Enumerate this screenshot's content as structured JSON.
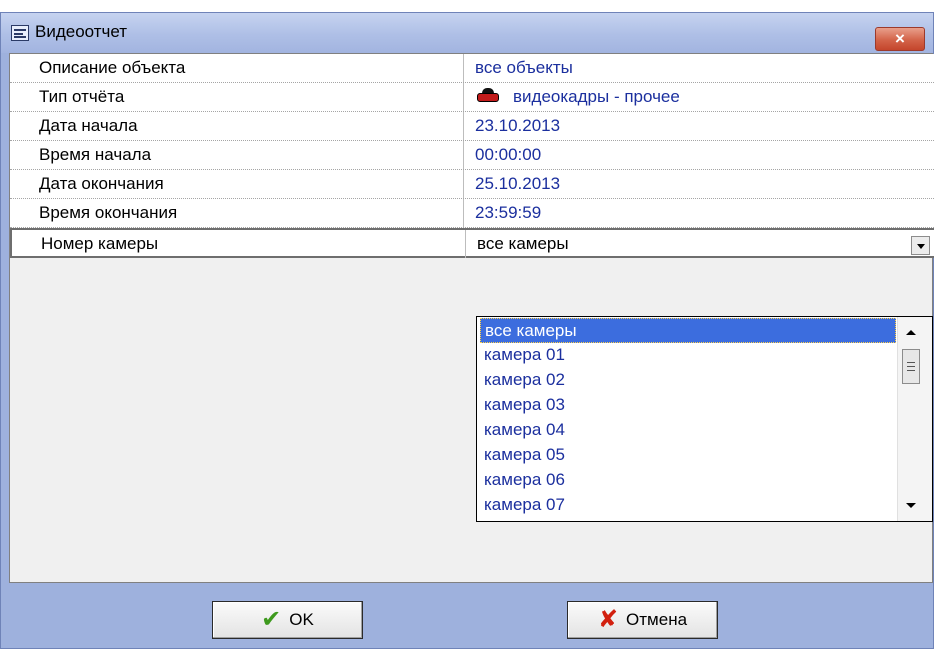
{
  "window": {
    "title": "Видеоотчет",
    "close_label": "×"
  },
  "fields": [
    {
      "name": "Описание объекта",
      "value": "все объекты"
    },
    {
      "name": "Тип отчёта",
      "value": "видеокадры - прочее",
      "icon": "car-icon"
    },
    {
      "name": "Дата начала",
      "value": "23.10.2013"
    },
    {
      "name": "Время начала",
      "value": "00:00:00"
    },
    {
      "name": "Дата окончания",
      "value": "25.10.2013"
    },
    {
      "name": "Время окончания",
      "value": "23:59:59"
    },
    {
      "name": "Номер камеры",
      "value": "все камеры",
      "selected": true
    }
  ],
  "dropdown": {
    "options": [
      "все камеры",
      "камера  01",
      "камера  02",
      "камера  03",
      "камера  04",
      "камера  05",
      "камера  06",
      "камера  07"
    ],
    "highlighted": "все камеры"
  },
  "buttons": {
    "ok_label": "OK",
    "cancel_label": "Отмена"
  },
  "colors": {
    "frame": "#9eb1dd",
    "value_text": "#1b2f9e",
    "highlight": "#3c6dde"
  }
}
